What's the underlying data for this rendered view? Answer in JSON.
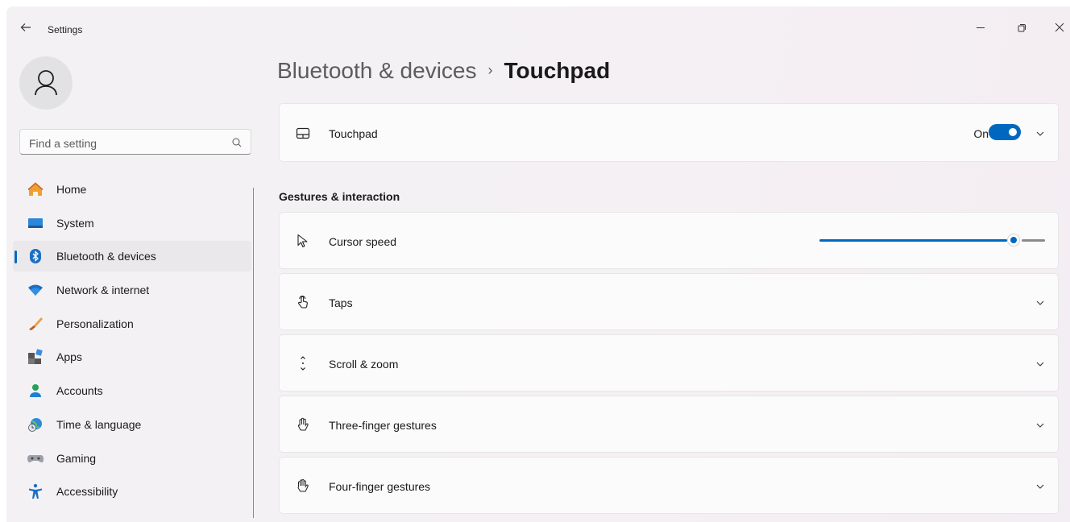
{
  "window": {
    "title": "Settings"
  },
  "search": {
    "placeholder": "Find a setting"
  },
  "sidebar": {
    "items": [
      {
        "label": "Home",
        "icon": "home-icon",
        "active": false
      },
      {
        "label": "System",
        "icon": "system-icon",
        "active": false
      },
      {
        "label": "Bluetooth & devices",
        "icon": "bluetooth-icon",
        "active": true
      },
      {
        "label": "Network & internet",
        "icon": "wifi-icon",
        "active": false
      },
      {
        "label": "Personalization",
        "icon": "brush-icon",
        "active": false
      },
      {
        "label": "Apps",
        "icon": "apps-icon",
        "active": false
      },
      {
        "label": "Accounts",
        "icon": "person-icon",
        "active": false
      },
      {
        "label": "Time & language",
        "icon": "globe-clock-icon",
        "active": false
      },
      {
        "label": "Gaming",
        "icon": "gamepad-icon",
        "active": false
      },
      {
        "label": "Accessibility",
        "icon": "accessibility-icon",
        "active": false
      }
    ]
  },
  "breadcrumb": {
    "parent": "Bluetooth & devices",
    "separator": "›",
    "current": "Touchpad"
  },
  "touchpad": {
    "label": "Touchpad",
    "state": "On",
    "enabled": true
  },
  "section": {
    "title": "Gestures & interaction"
  },
  "cursor_speed": {
    "label": "Cursor speed",
    "value": 0.86
  },
  "settings": [
    {
      "label": "Taps",
      "icon": "tap-icon"
    },
    {
      "label": "Scroll & zoom",
      "icon": "scroll-icon"
    },
    {
      "label": "Three-finger gestures",
      "icon": "three-finger-icon"
    },
    {
      "label": "Four-finger gestures",
      "icon": "four-finger-icon"
    }
  ],
  "colors": {
    "accent": "#0067c0"
  }
}
